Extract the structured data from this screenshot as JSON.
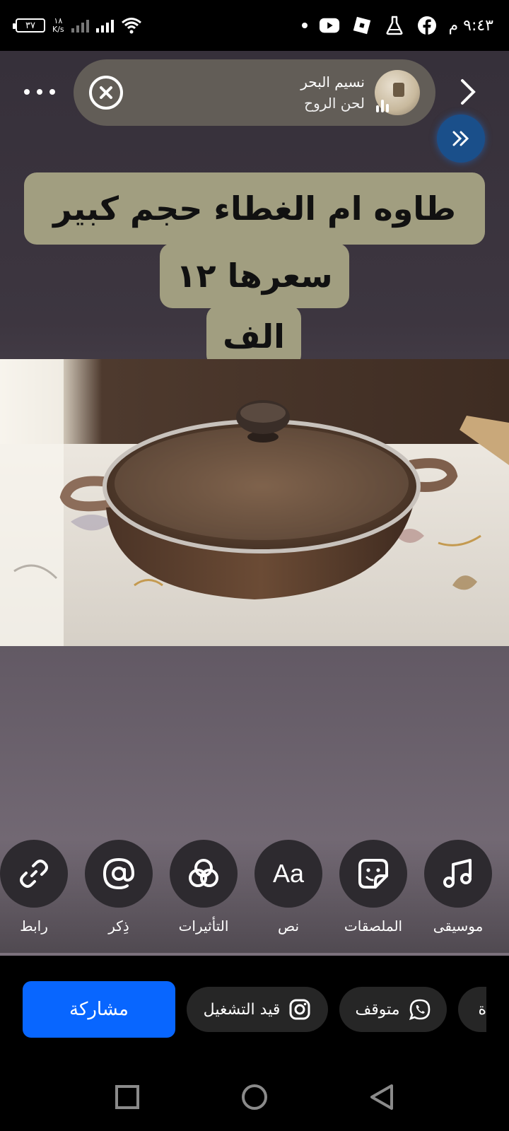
{
  "status_bar": {
    "time": "٩:٤٣ م",
    "battery": "٣٧",
    "speed_value": "١٨",
    "speed_unit": "K/s",
    "icons": [
      "battery-icon",
      "signal-icon",
      "signal-icon",
      "wifi-icon",
      "dot-icon",
      "youtube-icon",
      "roblox-icon",
      "flask-icon",
      "facebook-icon"
    ]
  },
  "music": {
    "title": "نسيم البحر",
    "artist": "لحن الروح",
    "close_icon": "close-circle-icon",
    "album_art": "album-art-icon"
  },
  "header": {
    "more_icon": "more-horizontal-icon",
    "next_icon": "chevron-right-icon",
    "expand_icon": "double-chevron-right-icon"
  },
  "caption": {
    "line1": "طاوه ام الغطاء حجم كبير",
    "line2": "سعرها ١٢",
    "line3": "الف"
  },
  "photo": {
    "subject": "pot-with-glass-lid-photo"
  },
  "tools": [
    {
      "label": "رابط",
      "icon": "link-icon"
    },
    {
      "label": "ذِكر",
      "icon": "at-icon"
    },
    {
      "label": "التأثيرات",
      "icon": "effects-icon"
    },
    {
      "label": "نص",
      "icon": "text-aa-icon"
    },
    {
      "label": "الملصقات",
      "icon": "sticker-icon"
    },
    {
      "label": "موسيقى",
      "icon": "music-note-icon"
    }
  ],
  "share": {
    "share_label": "مشاركة",
    "destinations": [
      {
        "label": "قيد التشغيل",
        "icon": "instagram-icon"
      },
      {
        "label": "متوقف",
        "icon": "whatsapp-icon"
      },
      {
        "label": "ة",
        "icon": ""
      }
    ],
    "share_color": "#0866ff"
  },
  "nav": {
    "items": [
      "recents-icon",
      "home-icon",
      "back-icon"
    ]
  }
}
